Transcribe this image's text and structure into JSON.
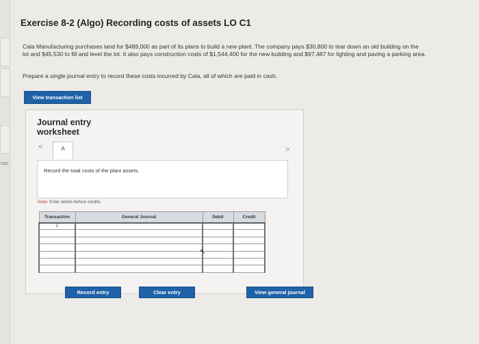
{
  "exercise": {
    "title": "Exercise 8-2 (Algo) Recording costs of assets LO C1",
    "description": "Cala Manufacturing purchases land for $489,000 as part of its plans to build a new plant. The company pays $30,800 to tear down an old building on the lot and $45,530 to fill and level the lot. It also pays construction costs of $1,544,400 for the new building and $97,487 for lighting and paving a parking area.",
    "prompt": "Prepare a single journal entry to record these costs incurred by Cala, all of which are paid in cash."
  },
  "sidebar": {
    "fragment_text": "ces"
  },
  "buttons": {
    "view_transaction_list": "View transaction list",
    "record_entry": "Record entry",
    "clear_entry": "Clear entry",
    "view_general_journal": "View general journal"
  },
  "worksheet": {
    "title": "Journal entry worksheet",
    "prev_arrow": "<",
    "next_arrow": ">",
    "tab_label": "A",
    "instruction": "Record the total costs of the plant assets.",
    "note_label": "Note:",
    "note_text": "Enter debits before credits."
  },
  "journal": {
    "headers": {
      "transaction": "Transaction",
      "general_journal": "General Journal",
      "debit": "Debit",
      "credit": "Credit"
    },
    "rows": [
      {
        "transaction": "1"
      },
      {
        "transaction": ""
      },
      {
        "transaction": ""
      },
      {
        "transaction": ""
      },
      {
        "transaction": ""
      },
      {
        "transaction": ""
      },
      {
        "transaction": ""
      }
    ]
  },
  "colors": {
    "accent_blue": "#1f62a8",
    "header_gray": "#d7dbe2",
    "page_bg": "#ecebe8"
  }
}
